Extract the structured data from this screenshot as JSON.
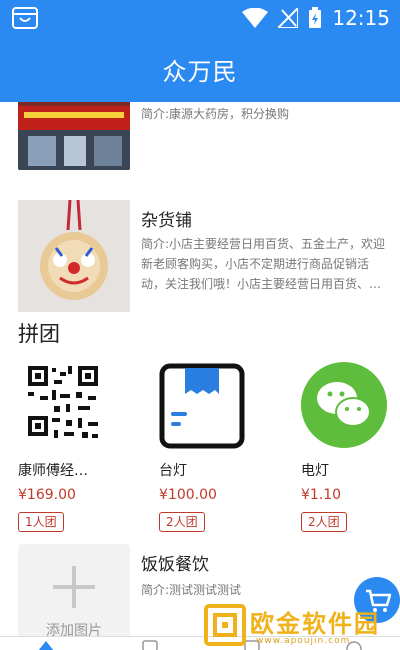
{
  "status_bar": {
    "time": "12:15"
  },
  "header": {
    "title": "众万民"
  },
  "shops": [
    {
      "name": "",
      "desc": "简介:康源大药房，积分换购"
    },
    {
      "name": "杂货铺",
      "desc": "简介:小店主要经营日用百货、五金土产，欢迎新老顾客购买，小店不定期进行商品促销活动，关注我们哦！小店主要经营日用百货、…"
    },
    {
      "name": "饭饭餐饮",
      "desc": "简介:测试测试测试"
    }
  ],
  "group_section": {
    "title": "拼团",
    "items": [
      {
        "name": "康师傅经…",
        "price": "¥169.00",
        "badge": "1人团",
        "icon": "qr-code-icon"
      },
      {
        "name": "台灯",
        "price": "¥100.00",
        "badge": "2人团",
        "icon": "box-icon"
      },
      {
        "name": "电灯",
        "price": "¥1.10",
        "badge": "2人团",
        "icon": "wechat-icon"
      }
    ]
  },
  "add_picture_label": "添加图片",
  "watermark": {
    "text": "欧金软件园",
    "sub": "www.apoujin.com"
  },
  "colors": {
    "primary": "#2a8af2",
    "price": "#c0392b",
    "watermark": "#f0b21b"
  }
}
